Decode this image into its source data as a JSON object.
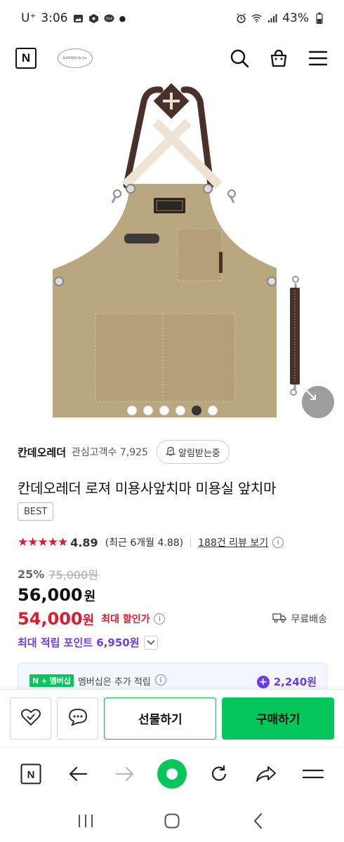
{
  "status_bar": {
    "carrier": "U⁺",
    "time": "3:06",
    "talk_label": "TALK",
    "battery": "43%"
  },
  "header": {
    "brand_logo_text": "KANDEO & Co."
  },
  "gallery": {
    "image_count": 6,
    "active_index": 4
  },
  "store": {
    "name": "칸데오레더",
    "fans_label": "관심고객수 7,925",
    "notify_label": "알림받는중"
  },
  "product": {
    "title": "칸데오레더 로져 미용사앞치마 미용실 앞치마",
    "badge": "BEST",
    "stars": "★★★★★",
    "rating": "4.89",
    "rating_recent": "(최근 6개월 4.88)",
    "review_link": "188건 리뷰 보기"
  },
  "price": {
    "discount_rate": "25%",
    "original_price": "75,000원",
    "sale_price": "56,000",
    "sale_unit": "원",
    "max_discount_price": "54,000",
    "max_discount_unit": "원",
    "max_discount_label": "최대 할인가",
    "shipping": "무료배송",
    "points_label": "최대 적립 포인트 6,950원"
  },
  "membership": {
    "badge_n": "N",
    "badge_plus": "+",
    "badge_text": "멤버십",
    "text": "멤버십은 추가 적립",
    "points": "2,240원"
  },
  "actions": {
    "gift_label": "선물하기",
    "buy_label": "구매하기"
  },
  "colors": {
    "naver_green": "#03c75a",
    "sale_red": "#e01a2e",
    "points_purple": "#6a3df0",
    "apron_tan": "#b9a77f"
  }
}
